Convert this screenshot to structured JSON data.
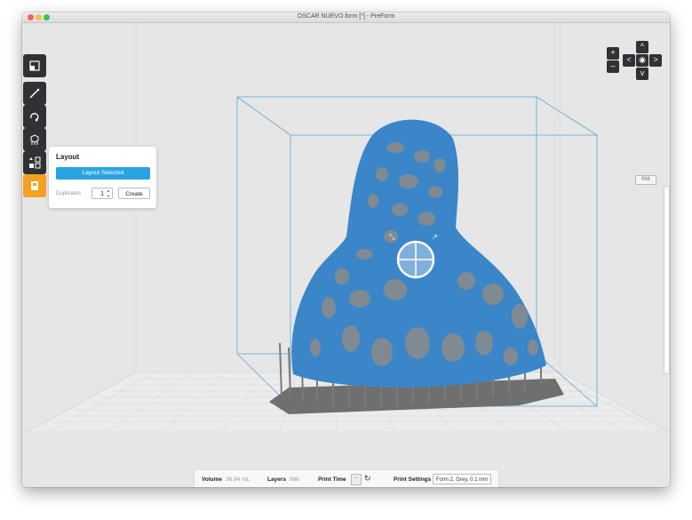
{
  "window": {
    "title": "OSCAR NUEVO.form [*] - PreForm"
  },
  "toolbar": {
    "items": [
      {
        "name": "scale-tool",
        "icon": "scale-icon"
      },
      {
        "name": "magic-wand-tool",
        "icon": "magic-wand-icon"
      },
      {
        "name": "orient-tool",
        "icon": "rotate-icon"
      },
      {
        "name": "supports-tool",
        "icon": "supports-icon"
      },
      {
        "name": "layout-tool",
        "icon": "layout-icon"
      },
      {
        "name": "print-tool",
        "icon": "printer-icon",
        "active": true
      }
    ]
  },
  "layout_panel": {
    "title": "Layout",
    "layout_button": "Layout Selected",
    "duplicates_label": "Duplicates",
    "duplicates_value": "1",
    "create_button": "Create"
  },
  "navigation": {
    "zoom_in": "+",
    "zoom_out": "–",
    "up": "^",
    "down": "v",
    "left": "<",
    "right": ">"
  },
  "zoom_level": "866",
  "status": {
    "volume_label": "Volume",
    "volume_value": "36.84 mL",
    "layers_label": "Layers",
    "layers_value": "866",
    "print_time_label": "Print Time",
    "print_time_value": "--",
    "print_settings_label": "Print Settings",
    "print_settings_value": "Form 2, Grey, 0.1 mm"
  },
  "colors": {
    "accent": "#2aa3e3",
    "toolbar": "#2f3134",
    "active_tool": "#f5a023",
    "model": "#3b86c8",
    "supports": "#777777",
    "build_volume": "#5fa5d6"
  }
}
